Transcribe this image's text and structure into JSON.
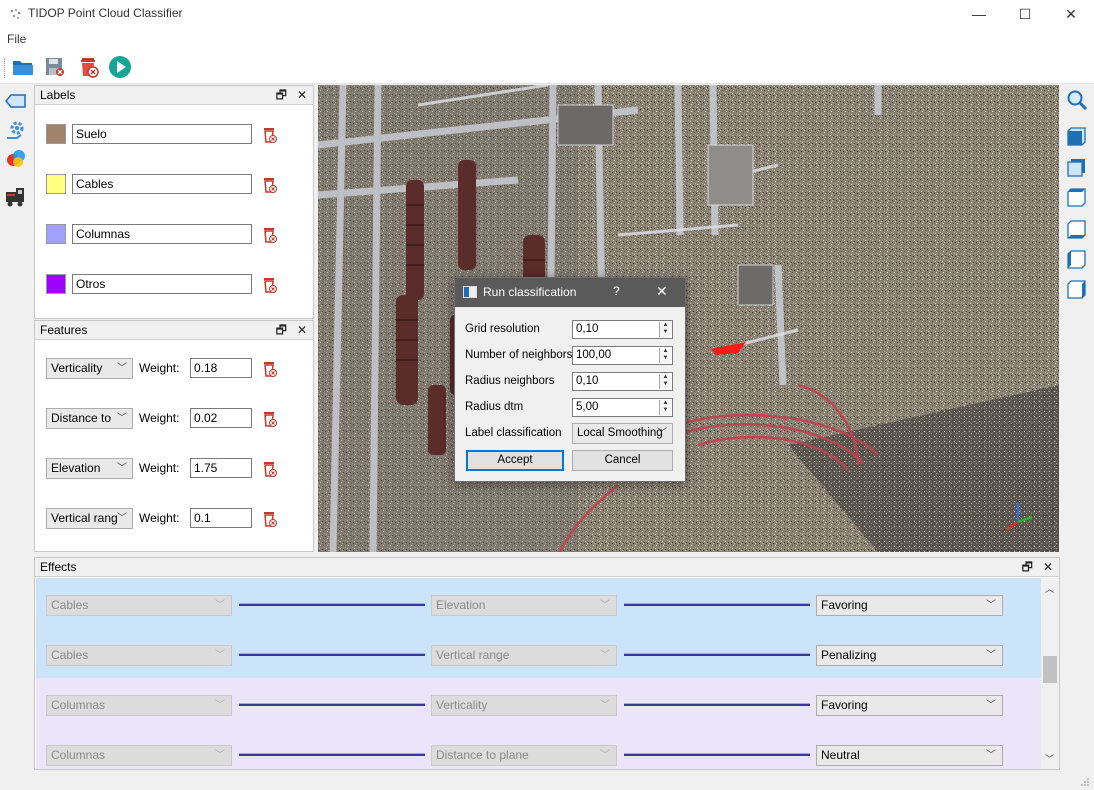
{
  "app": {
    "title": "TIDOP Point Cloud Classifier"
  },
  "window_controls": {
    "minimize": "—",
    "maximize": "☐",
    "close": "✕"
  },
  "menu": {
    "file": "File"
  },
  "labels_panel": {
    "title": "Labels",
    "items": [
      {
        "name": "Suelo",
        "color": "#a0826d"
      },
      {
        "name": "Cables",
        "color": "#ffff80"
      },
      {
        "name": "Columnas",
        "color": "#a0a0ff"
      },
      {
        "name": "Otros",
        "color": "#a000ff"
      }
    ]
  },
  "features_panel": {
    "title": "Features",
    "weight_label": "Weight:",
    "items": [
      {
        "feature": "Verticality",
        "weight": "0.18"
      },
      {
        "feature": "Distance to",
        "weight": "0.02"
      },
      {
        "feature": "Elevation",
        "weight": "1.75"
      },
      {
        "feature": "Vertical rang",
        "weight": "0.1"
      }
    ]
  },
  "dialog": {
    "title": "Run classification",
    "help": "?",
    "close": "✕",
    "fields": [
      {
        "label": "Grid resolution",
        "value": "0,10"
      },
      {
        "label": "Number of neighbors",
        "value": "100,00"
      },
      {
        "label": "Radius neighbors",
        "value": "0,10"
      },
      {
        "label": "Radius dtm",
        "value": "5,00"
      }
    ],
    "label_classification": {
      "label": "Label classification",
      "value": "Local Smoothing"
    },
    "accept": "Accept",
    "cancel": "Cancel"
  },
  "effects_panel": {
    "title": "Effects",
    "rows": [
      {
        "label": "Cables",
        "feature": "Elevation",
        "effect": "Favoring",
        "bg": "#cce4fa"
      },
      {
        "label": "Cables",
        "feature": "Vertical range",
        "effect": "Penalizing",
        "bg": "#cce4fa"
      },
      {
        "label": "Columnas",
        "feature": "Verticality",
        "effect": "Favoring",
        "bg": "#ebe5fa"
      },
      {
        "label": "Columnas",
        "feature": "Distance to plane",
        "effect": "Neutral",
        "bg": "#ebe5fa"
      }
    ]
  }
}
